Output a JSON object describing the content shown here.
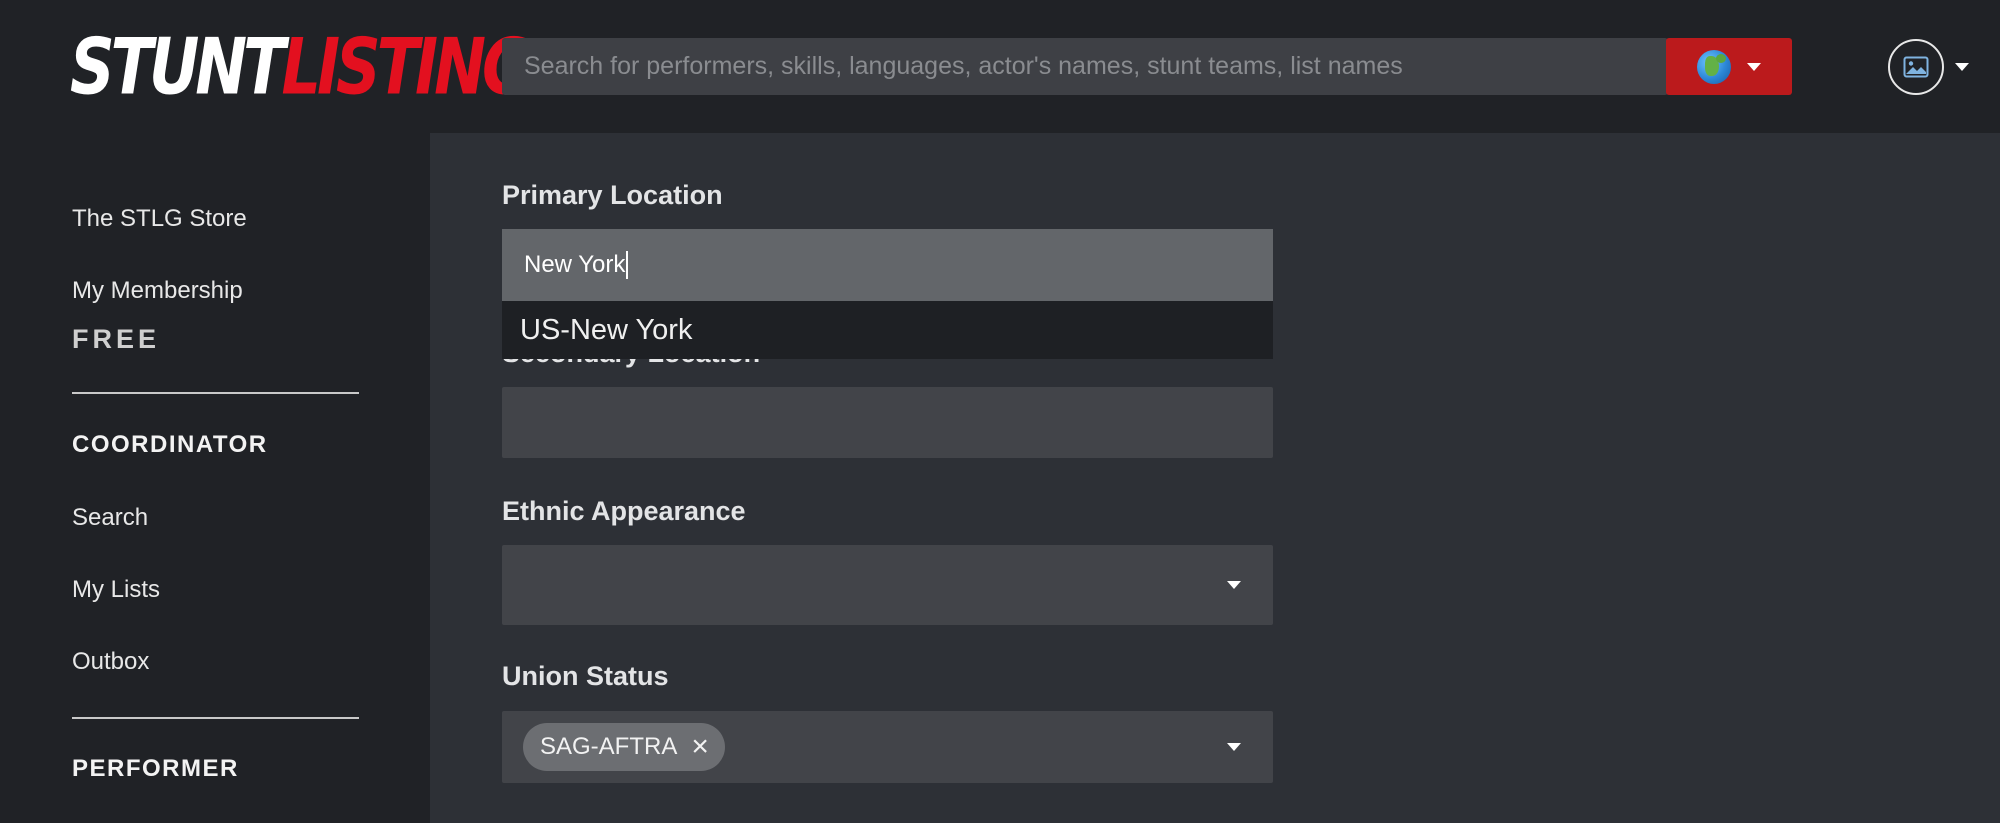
{
  "header": {
    "logo_part1": "STUNT",
    "logo_part2": "LISTING",
    "search_placeholder": "Search for performers, skills, languages, actor's names, stunt teams, list names",
    "region_icon": "globe-icon",
    "avatar_icon": "image-icon"
  },
  "sidebar": {
    "items_top": [
      {
        "label": "The STLG Store"
      },
      {
        "label": "My Membership"
      }
    ],
    "membership_tier": "FREE",
    "coordinator": {
      "title": "COORDINATOR",
      "items": [
        {
          "label": "Search"
        },
        {
          "label": "My Lists"
        },
        {
          "label": "Outbox"
        }
      ]
    },
    "performer": {
      "title": "PERFORMER"
    }
  },
  "form": {
    "primary_location": {
      "label": "Primary Location",
      "value": "New York",
      "suggestions": [
        "US-New York"
      ]
    },
    "secondary_location": {
      "label": "Secondary Location",
      "value": ""
    },
    "ethnic_appearance": {
      "label": "Ethnic Appearance",
      "value": ""
    },
    "union_status": {
      "label": "Union Status",
      "chips": [
        "SAG-AFTRA"
      ]
    }
  },
  "colors": {
    "brand_red": "#e3101f",
    "region_button": "#bb1a1c",
    "header_bg": "#202226",
    "main_bg": "#2d3036"
  }
}
